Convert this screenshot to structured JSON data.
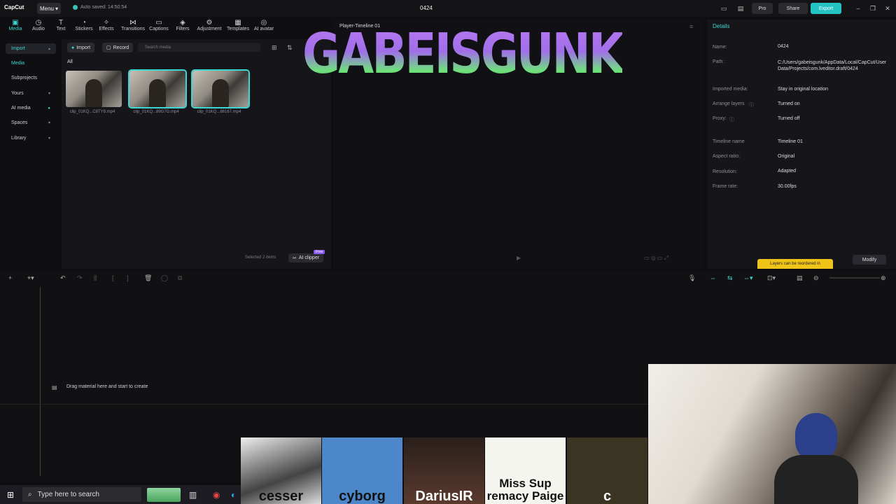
{
  "topbar": {
    "logo": "CapCut",
    "menu_label": "Menu",
    "autosave": "Auto saved: 14:50:54",
    "title": "0424",
    "pro_label": "Pro",
    "share_label": "Share",
    "export_label": "Export"
  },
  "tool_tabs": [
    {
      "label": "Media",
      "icon": "media-icon"
    },
    {
      "label": "Audio",
      "icon": "audio-icon"
    },
    {
      "label": "Text",
      "icon": "text-icon"
    },
    {
      "label": "Stickers",
      "icon": "stickers-icon"
    },
    {
      "label": "Effects",
      "icon": "effects-icon"
    },
    {
      "label": "Transitions",
      "icon": "transitions-icon"
    },
    {
      "label": "Captions",
      "icon": "captions-icon"
    },
    {
      "label": "Filters",
      "icon": "filters-icon"
    },
    {
      "label": "Adjustment",
      "icon": "adjustment-icon"
    },
    {
      "label": "Templates",
      "icon": "templates-icon"
    },
    {
      "label": "AI avatar",
      "icon": "ai-avatar-icon"
    }
  ],
  "leftnav": [
    {
      "label": "Import"
    },
    {
      "label": "Media"
    },
    {
      "label": "Subprojects"
    },
    {
      "label": "Yours"
    },
    {
      "label": "AI media"
    },
    {
      "label": "Spaces"
    },
    {
      "label": "Library"
    }
  ],
  "media": {
    "import_label": "Import",
    "record_label": "Record",
    "search_placeholder": "Search media",
    "filter_all": "All",
    "clips": [
      {
        "name": "clip_01KQ...C8TY8.mp4"
      },
      {
        "name": "clip_01KQ...89G7G.mp4"
      },
      {
        "name": "clip_01KQ...88167.mp4"
      }
    ],
    "selected_text": "Selected 2 items",
    "ai_clipper": "AI clipper",
    "ai_clipper_badge": "Free"
  },
  "player": {
    "title": "Player-Timeline 01",
    "overlay_text": "GABEISGUNK"
  },
  "details": {
    "title": "Details",
    "rows": [
      {
        "label": "Name:",
        "value": "0424"
      },
      {
        "label": "Path:",
        "value": "C:/Users/gabeisgunk/AppData/Local/CapCut/User Data/Projects/com.lveditor.draft/0424"
      },
      {
        "label": "Imported media:",
        "value": "Stay in original location"
      },
      {
        "label": "Arrange layers",
        "value": "Turned on"
      },
      {
        "label": "Proxy:",
        "value": "Turned off"
      },
      {
        "label": "Timeline name",
        "value": "Timeline 01"
      },
      {
        "label": "Aspect ratio:",
        "value": "Original"
      },
      {
        "label": "Resolution:",
        "value": "Adapted"
      },
      {
        "label": "Frame rate:",
        "value": "30.00fps"
      }
    ],
    "modify_label": "Modify",
    "tip": "Layers can be reordered in"
  },
  "timeline": {
    "drag_text": "Drag material here and start to create"
  },
  "overlay_tiles": [
    {
      "text": "cesser"
    },
    {
      "text": "cyborg"
    },
    {
      "text": "DariusIR"
    },
    {
      "text": "Miss Sup remacy Paige"
    },
    {
      "text": "c"
    }
  ],
  "taskbar": {
    "search_placeholder": "Type here to search"
  }
}
